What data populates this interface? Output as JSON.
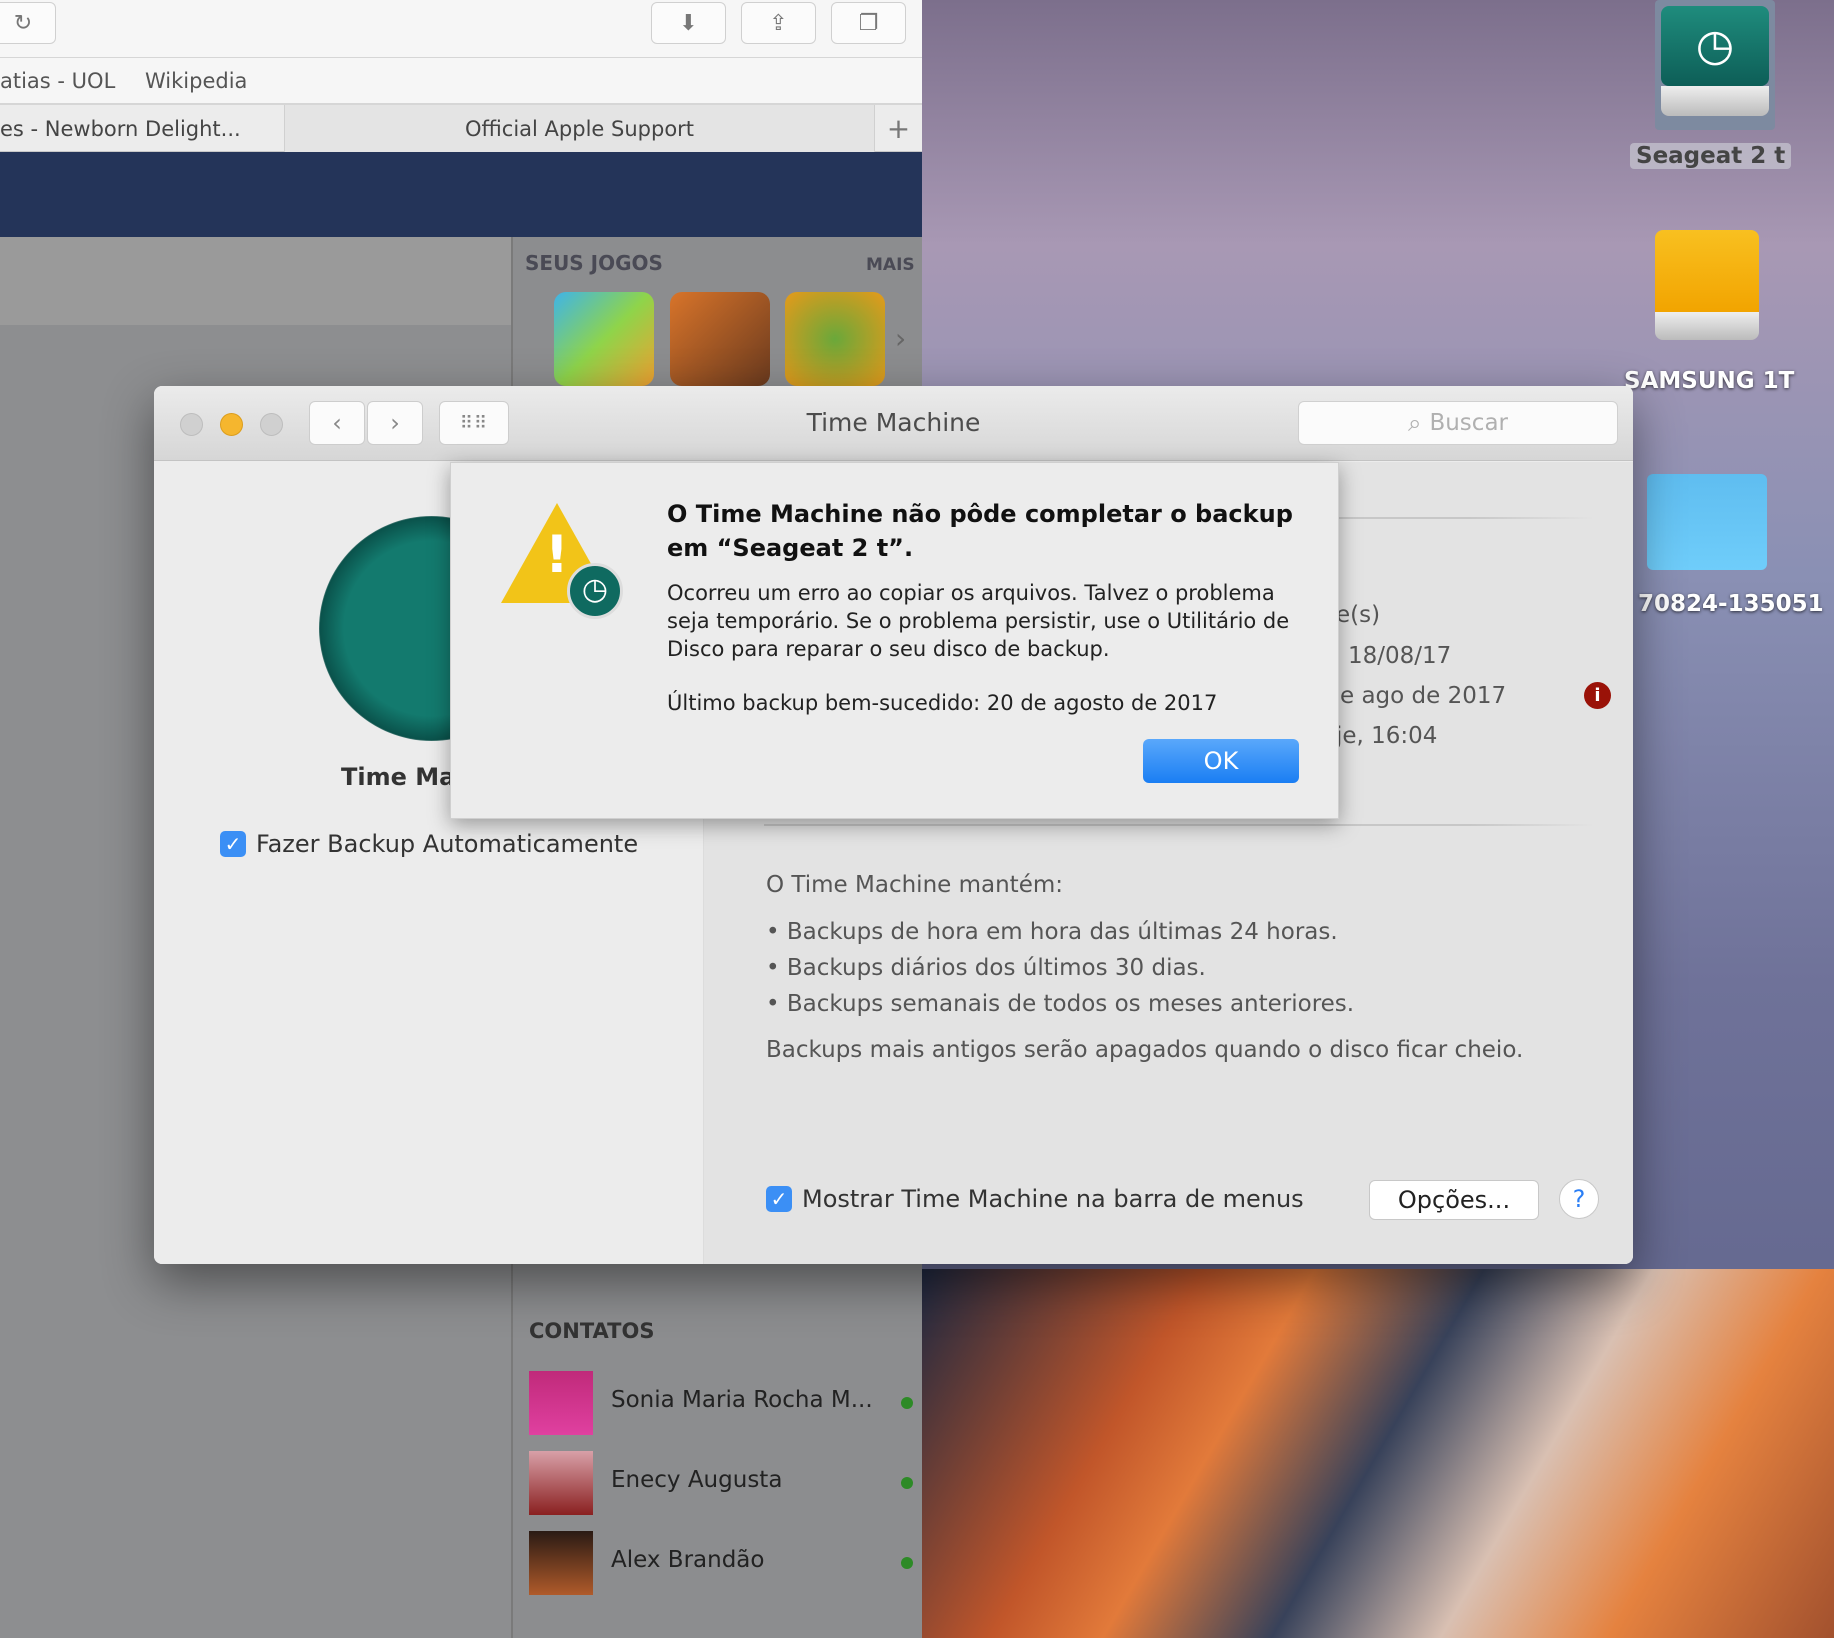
{
  "safari": {
    "bookmarks": [
      "atias - UOL",
      "Wikipedia"
    ],
    "tabs": [
      "es - Newborn Delight...",
      "Official Apple Support"
    ],
    "sidebar": {
      "games_header": "SEUS JOGOS",
      "more_label": "MAIS",
      "contacts_header": "CONTATOS",
      "contacts": [
        {
          "name": "Sonia Maria Rocha M...",
          "online": true
        },
        {
          "name": "Enecy Augusta",
          "online": true
        },
        {
          "name": "Alex Brandão",
          "online": true
        }
      ]
    }
  },
  "desktop": {
    "icons": [
      {
        "label": "Seageat 2 t"
      },
      {
        "label": "SAMSUNG 1T"
      },
      {
        "label": "70824-135051"
      }
    ]
  },
  "window": {
    "title": "Time Machine",
    "search_placeholder": "Buscar",
    "app_name": "Time Ma",
    "auto_backup_label": "Fazer Backup Automaticamente",
    "status_lines": [
      "e(s)",
      "18/08/17",
      "e ago de 2017",
      "je, 16:04"
    ],
    "keeps_header": "O Time Machine mantém:",
    "bullets": [
      "Backups de hora em hora das últimas 24 horas.",
      "Backups diários dos últimos 30 dias.",
      "Backups semanais de todos os meses anteriores."
    ],
    "footnote": "Backups mais antigos serão apagados quando o disco ficar cheio.",
    "show_menu_label": "Mostrar Time Machine na barra de menus",
    "options_label": "Opções...",
    "help_label": "?"
  },
  "alert": {
    "title": "O Time Machine não pôde completar o backup em “Seageat 2 t”.",
    "message": "Ocorreu um erro ao copiar os arquivos. Talvez o problema seja temporário. Se o problema persistir, use o Utilitário de Disco para reparar o seu disco de backup.",
    "last_backup": "Último backup bem-sucedido: 20 de agosto de 2017",
    "ok_label": "OK"
  }
}
